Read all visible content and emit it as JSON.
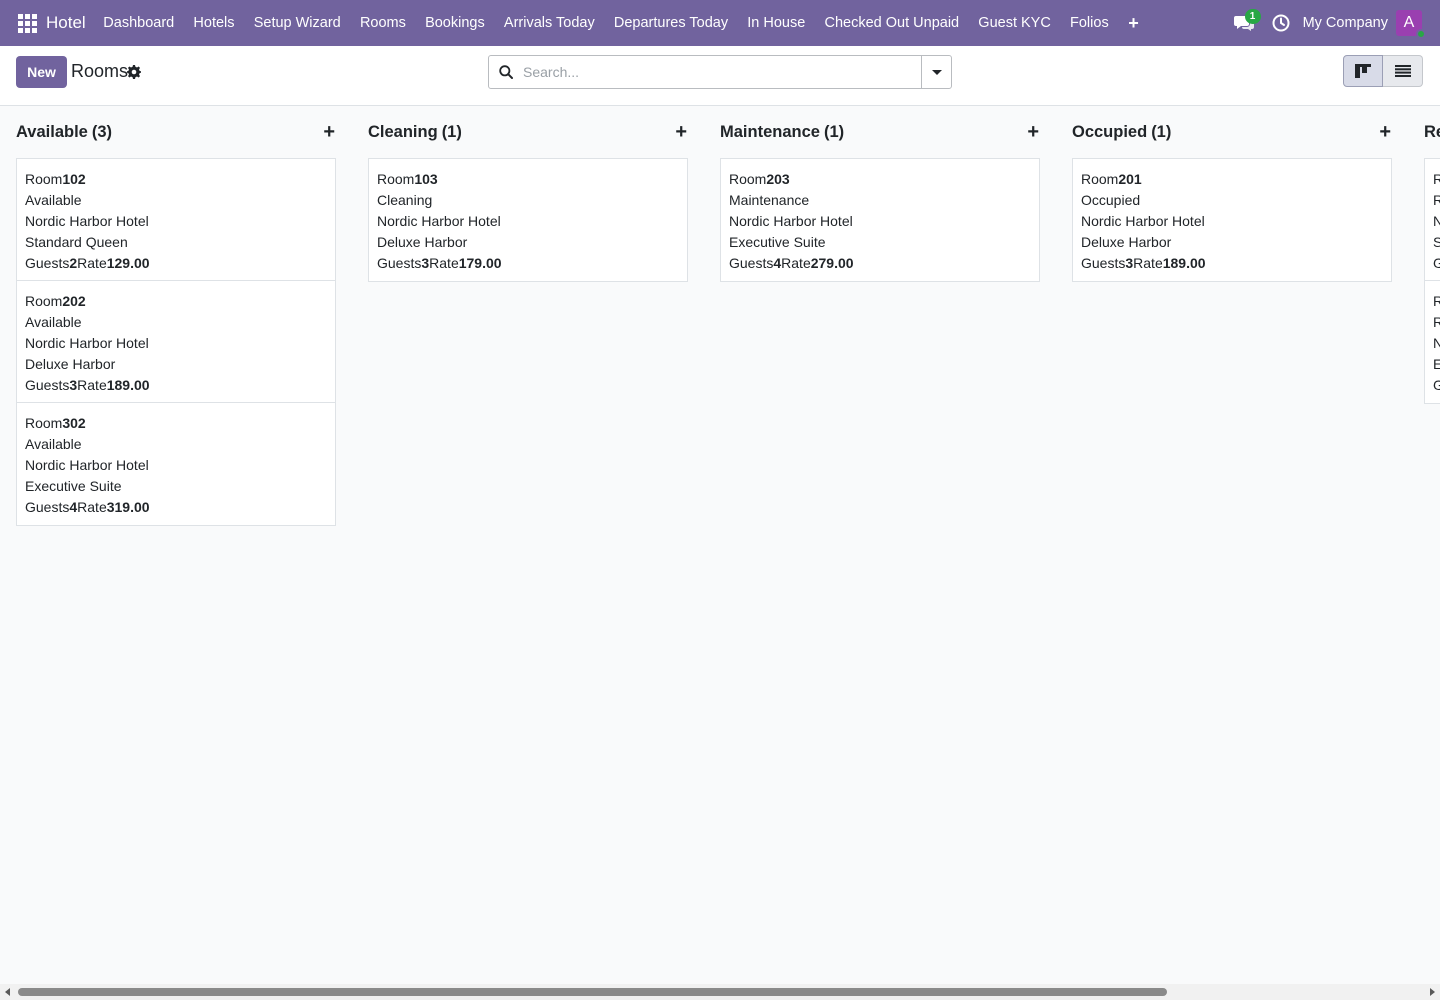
{
  "navbar": {
    "apps_icon": "apps-grid-icon",
    "brand": "Hotel",
    "menu": [
      "Dashboard",
      "Hotels",
      "Setup Wizard",
      "Rooms",
      "Bookings",
      "Arrivals Today",
      "Departures Today",
      "In House",
      "Checked Out Unpaid",
      "Guest KYC",
      "Folios"
    ],
    "more_icon": "plus-icon",
    "chat_badge": "1",
    "company": "My Company",
    "avatar_letter": "A",
    "colors": {
      "navbar": "#71639e",
      "badge": "#28a745",
      "avatar": "#9a3fb0"
    }
  },
  "control_panel": {
    "new_label": "New",
    "title": "Rooms",
    "search_placeholder": "Search...",
    "views": [
      "kanban",
      "list"
    ],
    "active_view": "kanban"
  },
  "kanban": {
    "columns": [
      {
        "title": "Available",
        "count": "(3)",
        "cards": [
          {
            "room_label": "Room",
            "room": "102",
            "status": "Available",
            "hotel": "Nordic Harbor Hotel",
            "type": "Standard Queen",
            "guests_label": "Guests",
            "guests": "2",
            "rate_label": "Rate",
            "rate": "129.00"
          },
          {
            "room_label": "Room",
            "room": "202",
            "status": "Available",
            "hotel": "Nordic Harbor Hotel",
            "type": "Deluxe Harbor",
            "guests_label": "Guests",
            "guests": "3",
            "rate_label": "Rate",
            "rate": "189.00"
          },
          {
            "room_label": "Room",
            "room": "302",
            "status": "Available",
            "hotel": "Nordic Harbor Hotel",
            "type": "Executive Suite",
            "guests_label": "Guests",
            "guests": "4",
            "rate_label": "Rate",
            "rate": "319.00"
          }
        ]
      },
      {
        "title": "Cleaning",
        "count": "(1)",
        "cards": [
          {
            "room_label": "Room",
            "room": "103",
            "status": "Cleaning",
            "hotel": "Nordic Harbor Hotel",
            "type": "Deluxe Harbor",
            "guests_label": "Guests",
            "guests": "3",
            "rate_label": "Rate",
            "rate": "179.00"
          }
        ]
      },
      {
        "title": "Maintenance",
        "count": "(1)",
        "cards": [
          {
            "room_label": "Room",
            "room": "203",
            "status": "Maintenance",
            "hotel": "Nordic Harbor Hotel",
            "type": "Executive Suite",
            "guests_label": "Guests",
            "guests": "4",
            "rate_label": "Rate",
            "rate": "279.00"
          }
        ]
      },
      {
        "title": "Occupied",
        "count": "(1)",
        "cards": [
          {
            "room_label": "Room",
            "room": "201",
            "status": "Occupied",
            "hotel": "Nordic Harbor Hotel",
            "type": "Deluxe Harbor",
            "guests_label": "Guests",
            "guests": "3",
            "rate_label": "Rate",
            "rate": "189.00"
          }
        ]
      },
      {
        "title": "Re",
        "count": "",
        "cards": [
          {
            "room_label": "R",
            "room": "",
            "status": "R",
            "hotel": "N",
            "type": "S",
            "guests_label": "G",
            "guests": "",
            "rate_label": "",
            "rate": ""
          },
          {
            "room_label": "R",
            "room": "",
            "status": "R",
            "hotel": "N",
            "type": "E",
            "guests_label": "G",
            "guests": "",
            "rate_label": "",
            "rate": ""
          }
        ]
      }
    ]
  }
}
